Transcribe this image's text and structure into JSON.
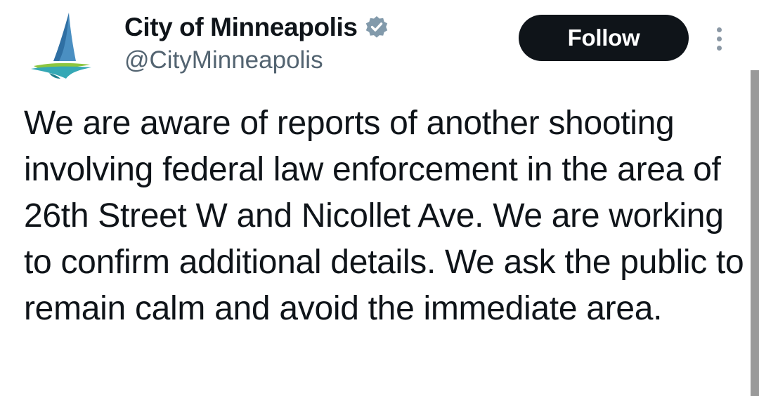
{
  "author": {
    "display_name": "City of Minneapolis",
    "handle": "@CityMinneapolis",
    "verified_badge_icon": "verified-badge-icon",
    "avatar_icon": "city-of-minneapolis-sail-logo",
    "verified_color": "#829aab"
  },
  "actions": {
    "follow_label": "Follow",
    "more_icon": "more-vertical-icon"
  },
  "tweet": {
    "text": "We are aware of reports of another shooting involving federal law enforcement in the area of 26th Street W and Nicollet Ave. We are working to confirm additional details. We ask the public to remain calm and avoid the immediate area."
  },
  "colors": {
    "text": "#0f1419",
    "secondary_text": "#536471",
    "follow_button_bg": "#0f1419",
    "follow_button_text": "#ffffff"
  }
}
